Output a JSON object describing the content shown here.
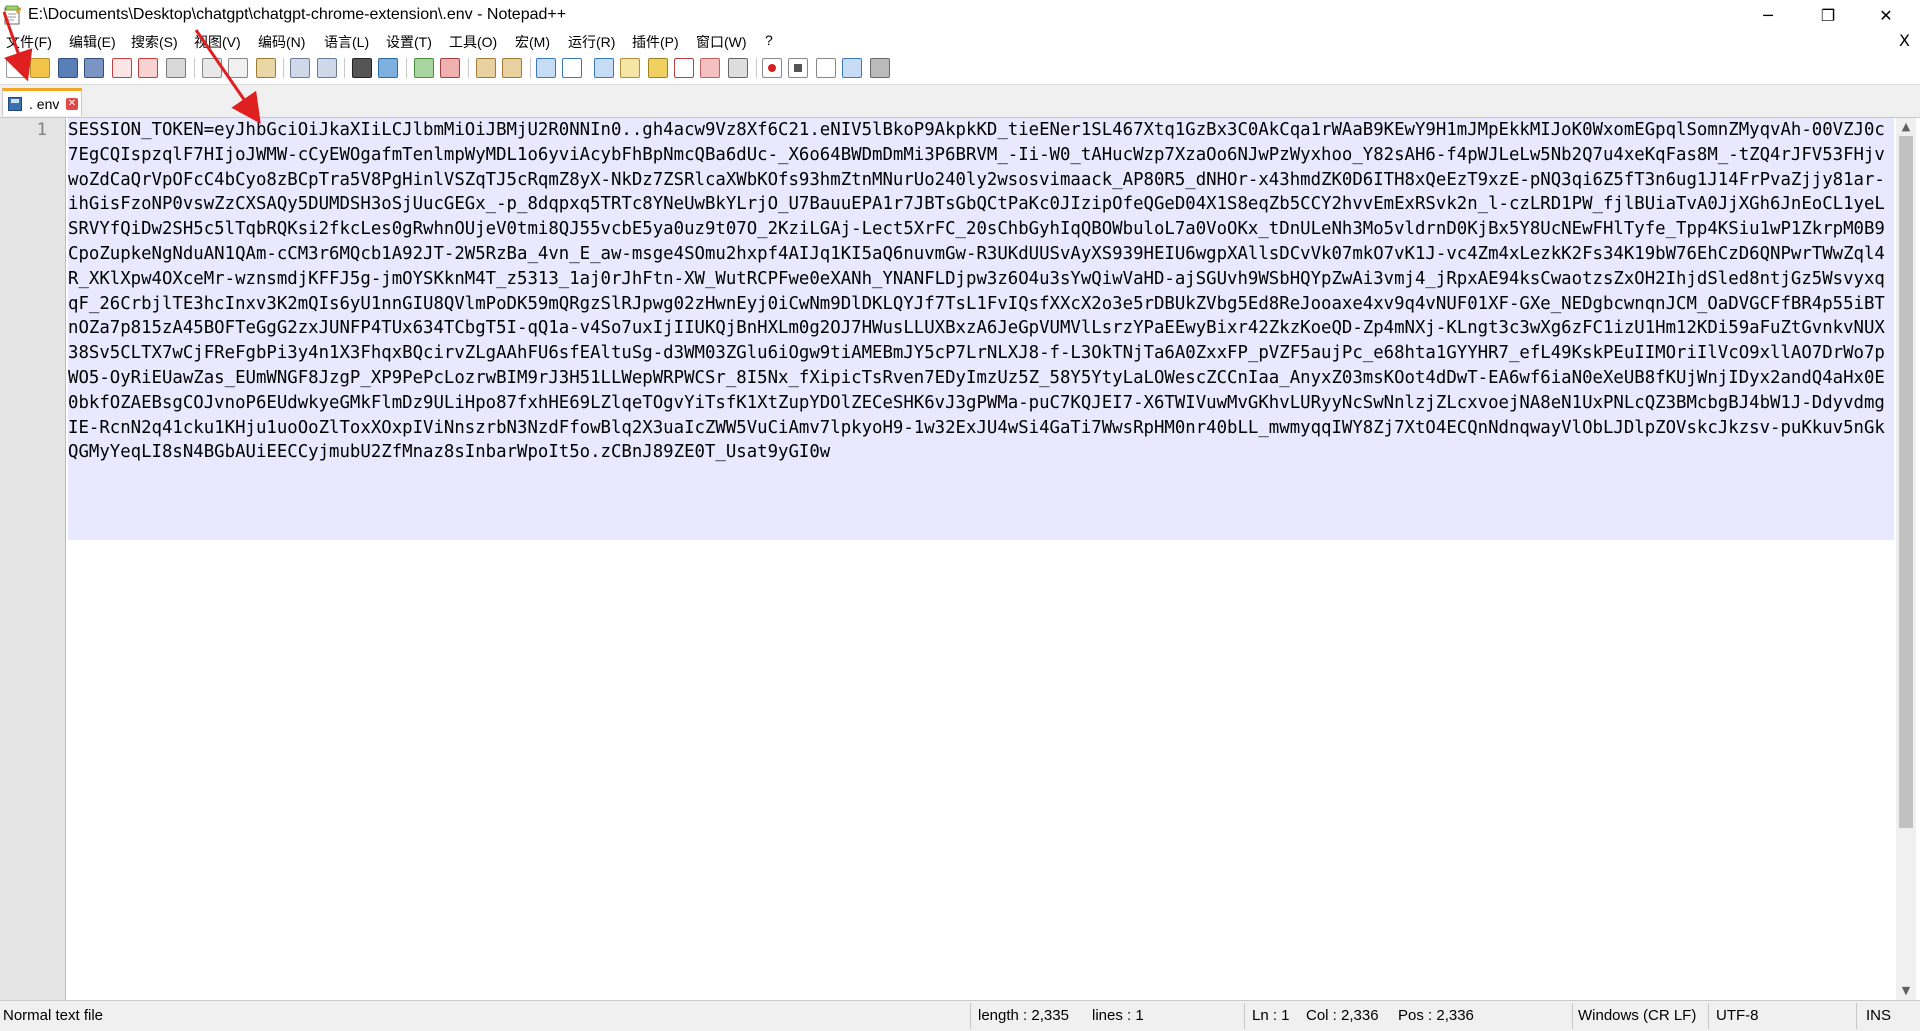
{
  "window": {
    "title": "E:\\Documents\\Desktop\\chatgpt\\chatgpt-chrome-extension\\.env - Notepad++",
    "minimize": "─",
    "maximize": "❐",
    "close": "✕"
  },
  "menu": {
    "items": [
      "文件(F)",
      "编辑(E)",
      "搜索(S)",
      "视图(V)",
      "编码(N)",
      "语言(L)",
      "设置(T)",
      "工具(O)",
      "宏(M)",
      "运行(R)",
      "插件(P)",
      "窗口(W)",
      "?"
    ],
    "close_doc": "X"
  },
  "tab": {
    "label": ". env",
    "close": "✕"
  },
  "editor": {
    "line_number": "1",
    "content": "SESSION_TOKEN=eyJhbGciOiJkaXIiLCJlbmMiOiJBMjU2R0NNIn0..gh4acw9Vz8Xf6C21.eNIV5lBkoP9AkpkKD_tieENer1SL467Xtq1GzBx3C0AkCqa1rWAaB9KEwY9H1mJMpEkkMIJoK0WxomEGpqlSomnZMyqvAh-00VZJ0c7EgCQIspzqlF7HIjoJWMW-cCyEWOgafmTenlmpWyMDL1o6yviAcybFhBpNmcQBa6dUc-_X6o64BWDmDmMi3P6BRVM_-Ii-W0_tAHucWzp7XzaOo6NJwPzWyxhoo_Y82sAH6-f4pWJLeLw5Nb2Q7u4xeKqFas8M_-tZQ4rJFV53FHjvwoZdCaQrVpOFcC4bCyo8zBCpTra5V8PgHinlVSZqTJ5cRqmZ8yX-NkDz7ZSRlcaXWbKOfs93hmZtnMNurUo240ly2wsosvimaack_AP80R5_dNHOr-x43hmdZK0D6ITH8xQeEzT9xzE-pNQ3qi6Z5fT3n6ug1J14FrPvaZjjy81ar-ihGisFzoNP0vswZzCXSAQy5DUMDSH3oSjUucGEGx_-p_8dqpxq5TRTc8YNeUwBkYLrjO_U7BauuEPA1r7JBTsGbQCtPaKc0JIzipOfeQGeD04X1S8eqZb5CCY2hvvEmExRSvk2n_l-czLRD1PW_fjlBUiaTvA0JjXGh6JnEoCL1yeLSRVYfQiDw2SH5c5lTqbRQKsi2fkcLes0gRwhnOUjeV0tmi8QJ55vcbE5ya0uz9t07O_2KziLGAj-Lect5XrFC_20sChbGyhIqQBOWbuloL7a0VoOKx_tDnULeNh3Mo5vldrnD0KjBx5Y8UcNEwFHlTyfe_Tpp4KSiu1wP1ZkrpM0B9CpoZupkeNgNduAN1QAm-cCM3r6MQcb1A92JT-2W5RzBa_4vn_E_aw-msge4SOmu2hxpf4AIJq1KI5aQ6nuvmGw-R3UKdUUSvAyXS939HEIU6wgpXAllsDCvVk07mkO7vK1J-vc4Zm4xLezkK2Fs34K19bW76EhCzD6QNPwrTWwZql4R_XKlXpw4OXceMr-wznsmdjKFFJ5g-jmOYSKknM4T_z5313_1aj0rJhFtn-XW_WutRCPFwe0eXANh_YNANFLDjpw3z6O4u3sYwQiwVaHD-ajSGUvh9WSbHQYpZwAi3vmj4_jRpxAE94ksCwaotzsZxOH2IhjdSled8ntjGz5WsvyxqqF_26CrbjlTE3hcInxv3K2mQIs6yU1nnGIU8QVlmPoDK59mQRgzSlRJpwg02zHwnEyj0iCwNm9DlDKLQYJf7TsL1FvIQsfXXcX2o3e5rDBUkZVbg5Ed8ReJooaxe4xv9q4vNUF01XF-GXe_NEDgbcwnqnJCM_OaDVGCFfBR4p55iBTnOZa7p815zA45BOFTeGgG2zxJUNFP4TUx634TCbgT5I-qQ1a-v4So7uxIjIIUKQjBnHXLm0g2OJ7HWusLLUXBxzA6JeGpVUMVlLsrzYPaEEwyBixr42ZkzKoeQD-Zp4mNXj-KLngt3c3wXg6zFC1izU1Hm12KDi59aFuZtGvnkvNUX38Sv5CLTX7wCjFReFgbPi3y4n1X3FhqxBQcirvZLgAAhFU6sfEAltuSg-d3WM03ZGlu6iOgw9tiAMEBmJY5cP7LrNLXJ8-f-L3OkTNjTa6A0ZxxFP_pVZF5aujPc_e68hta1GYYHR7_efL49KskPEuIIMOriIlVcO9xllAO7DrWo7pWO5-OyRiEUawZas_EUmWNGF8JzgP_XP9PePcLozrwBIM9rJ3H51LLWepWRPWCSr_8I5Nx_fXipicTsRven7EDyImzUz5Z_58Y5YtyLaLOWescZCCnIaa_AnyxZ03msKOot4dDwT-EA6wf6iaN0eXeUB8fKUjWnjIDyx2andQ4aHx0E0bkfOZAEBsgCOJvnoP6EUdwkyeGMkFlmDz9ULiHpo87fxhHE69LZlqeTOgvYiTsfK1XtZupYDOlZECeSHK6vJ3gPWMa-puC7KQJEI7-X6TWIVuwMvGKhvLURyyNcSwNnlzjZLcxvoejNA8eN1UxPNLcQZ3BMcbgBJ4bW1J-DdyvdmgIE-RcnN2q41cku1KHju1uoOoZlToxXOxpIViNnszrbN3NzdFfowBlq2X3uaIcZWW5VuCiAmv7lpkyoH9-1w32ExJU4wSi4GaTi7WwsRpHM0nr40bLL_mwmyqqIWY8Zj7XtO4ECQnNdnqwayVlObLJDlpZOVskcJkzsv-puKkuv5nGkQGMyYeqLI8sN4BGbAUiEECCyjmubU2ZfMnaz8sInbarWpoIt5o.zCBnJ89ZE0T_Usat9yGI0w"
  },
  "status": {
    "file_type": "Normal text file",
    "length": "length : 2,335",
    "lines": "lines : 1",
    "ln": "Ln : 1",
    "col": "Col : 2,336",
    "pos": "Pos : 2,336",
    "eol": "Windows (CR LF)",
    "encoding": "UTF-8",
    "mode": "INS"
  },
  "colors": {
    "accent_tab": "#f5a623",
    "selection": "#e8e8ff",
    "annotation_arrow": "#e02020"
  },
  "toolbar_icons": [
    "new-file-icon",
    "open-icon",
    "save-icon",
    "save-all-icon",
    "close-icon",
    "close-all-icon",
    "print-icon",
    "cut-icon",
    "copy-icon",
    "paste-icon",
    "undo-icon",
    "redo-icon",
    "find-icon",
    "replace-icon",
    "zoom-in-icon",
    "zoom-out-icon",
    "sync-v-icon",
    "sync-h-icon",
    "word-wrap-icon",
    "show-all-chars-icon",
    "indent-guide-icon",
    "doc-map-icon",
    "function-list-icon",
    "folder-workspace-icon",
    "monitor-icon",
    "record-macro-icon",
    "stop-macro-icon",
    "play-macro-icon",
    "run-macro-multiple-icon",
    "save-macro-icon"
  ]
}
